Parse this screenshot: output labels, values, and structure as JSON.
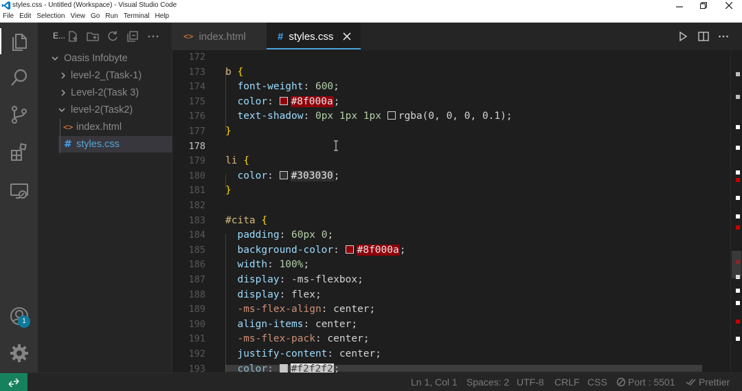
{
  "window": {
    "title": "styles.css - Untitled (Workspace) - Visual Studio Code",
    "menu": [
      "File",
      "Edit",
      "Selection",
      "View",
      "Go",
      "Run",
      "Terminal",
      "Help"
    ]
  },
  "activity_bar": {
    "icons": [
      "files-icon",
      "search-icon",
      "source-control-icon",
      "extensions-icon",
      "remote-explorer-icon",
      "accounts-icon",
      "settings-gear-icon"
    ],
    "accounts_badge": "1"
  },
  "sidebar": {
    "title": "E...",
    "tree": [
      {
        "label": "Oasis Infobyte",
        "kind": "folder",
        "expanded": true
      },
      {
        "label": "level-2_(Task-1)",
        "kind": "folder",
        "expanded": false
      },
      {
        "label": "Level-2(Task 3)",
        "kind": "folder",
        "expanded": false
      },
      {
        "label": "level-2(Task2)",
        "kind": "folder",
        "expanded": true
      },
      {
        "label": "index.html",
        "kind": "html",
        "icon": "<>"
      },
      {
        "label": "styles.css",
        "kind": "css",
        "icon": "#",
        "active": true
      }
    ]
  },
  "tabs": [
    {
      "label": "index.html",
      "icon": "<>",
      "active": false
    },
    {
      "label": "styles.css",
      "icon": "#",
      "active": true
    }
  ],
  "editor": {
    "lines": [
      {
        "n": "172",
        "tokens": []
      },
      {
        "n": "173",
        "tokens": [
          {
            "t": "b ",
            "c": "sel"
          },
          {
            "t": "{",
            "c": "brace"
          }
        ]
      },
      {
        "n": "174",
        "tokens": [
          {
            "t": "  font-weight",
            "c": "prop"
          },
          {
            "t": ": ",
            "c": "punc"
          },
          {
            "t": "600",
            "c": "num"
          },
          {
            "t": ";",
            "c": "punc"
          }
        ]
      },
      {
        "n": "175",
        "tokens": [
          {
            "t": "  color",
            "c": "prop"
          },
          {
            "t": ": ",
            "c": "punc"
          },
          {
            "t": "",
            "c": "swatch",
            "color": "#8f000a"
          },
          {
            "t": "#8f000a",
            "c": "hex",
            "hl": "#8f000a"
          },
          {
            "t": ";",
            "c": "punc"
          }
        ]
      },
      {
        "n": "176",
        "tokens": [
          {
            "t": "  text-shadow",
            "c": "prop"
          },
          {
            "t": ": ",
            "c": "punc"
          },
          {
            "t": "0px 1px 1px ",
            "c": "num"
          },
          {
            "t": "",
            "c": "swatch",
            "color": "#1e1e1e"
          },
          {
            "t": "rgba(0, 0, 0, 0.1)",
            "c": "plain"
          },
          {
            "t": ";",
            "c": "punc"
          }
        ]
      },
      {
        "n": "177",
        "tokens": [
          {
            "t": "}",
            "c": "brace"
          }
        ]
      },
      {
        "n": "178",
        "tokens": []
      },
      {
        "n": "179",
        "tokens": [
          {
            "t": "li ",
            "c": "sel"
          },
          {
            "t": "{",
            "c": "brace"
          }
        ]
      },
      {
        "n": "180",
        "tokens": [
          {
            "t": "  color",
            "c": "prop"
          },
          {
            "t": ": ",
            "c": "punc"
          },
          {
            "t": "",
            "c": "swatch",
            "color": "#303030"
          },
          {
            "t": "#303030",
            "c": "hex",
            "hl": "#303030"
          },
          {
            "t": ";",
            "c": "punc"
          }
        ]
      },
      {
        "n": "181",
        "tokens": [
          {
            "t": "}",
            "c": "brace"
          }
        ]
      },
      {
        "n": "182",
        "tokens": []
      },
      {
        "n": "183",
        "tokens": [
          {
            "t": "#cita ",
            "c": "sel"
          },
          {
            "t": "{",
            "c": "brace"
          }
        ]
      },
      {
        "n": "184",
        "tokens": [
          {
            "t": "  padding",
            "c": "prop"
          },
          {
            "t": ": ",
            "c": "punc"
          },
          {
            "t": "60px 0",
            "c": "num"
          },
          {
            "t": ";",
            "c": "punc"
          }
        ]
      },
      {
        "n": "185",
        "tokens": [
          {
            "t": "  background-color",
            "c": "prop"
          },
          {
            "t": ": ",
            "c": "punc"
          },
          {
            "t": "",
            "c": "swatch",
            "color": "#8f000a"
          },
          {
            "t": "#8f000a",
            "c": "hex",
            "hl": "#8f000a"
          },
          {
            "t": ";",
            "c": "punc"
          }
        ]
      },
      {
        "n": "186",
        "tokens": [
          {
            "t": "  width",
            "c": "prop"
          },
          {
            "t": ": ",
            "c": "punc"
          },
          {
            "t": "100%",
            "c": "num"
          },
          {
            "t": ";",
            "c": "punc"
          }
        ]
      },
      {
        "n": "187",
        "tokens": [
          {
            "t": "  display",
            "c": "prop"
          },
          {
            "t": ": ",
            "c": "punc"
          },
          {
            "t": "-ms-flexbox",
            "c": "plain"
          },
          {
            "t": ";",
            "c": "punc"
          }
        ]
      },
      {
        "n": "188",
        "tokens": [
          {
            "t": "  display",
            "c": "prop"
          },
          {
            "t": ": ",
            "c": "punc"
          },
          {
            "t": "flex",
            "c": "plain"
          },
          {
            "t": ";",
            "c": "punc"
          }
        ]
      },
      {
        "n": "189",
        "tokens": [
          {
            "t": "  -ms-flex-align",
            "c": "val"
          },
          {
            "t": ": ",
            "c": "punc"
          },
          {
            "t": "center",
            "c": "plain"
          },
          {
            "t": ";",
            "c": "punc"
          }
        ]
      },
      {
        "n": "190",
        "tokens": [
          {
            "t": "  align-items",
            "c": "prop"
          },
          {
            "t": ": ",
            "c": "punc"
          },
          {
            "t": "center",
            "c": "plain"
          },
          {
            "t": ";",
            "c": "punc"
          }
        ]
      },
      {
        "n": "191",
        "tokens": [
          {
            "t": "  -ms-flex-pack",
            "c": "val"
          },
          {
            "t": ": ",
            "c": "punc"
          },
          {
            "t": "center",
            "c": "plain"
          },
          {
            "t": ";",
            "c": "punc"
          }
        ]
      },
      {
        "n": "192",
        "tokens": [
          {
            "t": "  justify-content",
            "c": "prop"
          },
          {
            "t": ": ",
            "c": "punc"
          },
          {
            "t": "center",
            "c": "plain"
          },
          {
            "t": ";",
            "c": "punc"
          }
        ]
      },
      {
        "n": "193",
        "tokens": [
          {
            "t": "  color",
            "c": "prop"
          },
          {
            "t": ": ",
            "c": "punc"
          },
          {
            "t": "",
            "c": "swatch",
            "color": "#f2f2f2"
          },
          {
            "t": "#f2f2f2",
            "c": "hex",
            "hl": "#f2f2f2"
          },
          {
            "t": ";",
            "c": "punc"
          }
        ]
      }
    ],
    "current_line": "178"
  },
  "status_bar": {
    "position": "Ln 1, Col 1",
    "spaces": "Spaces: 2",
    "encoding": "UTF-8",
    "eol": "CRLF",
    "language": "CSS",
    "port": "Port : 5501",
    "formatter": "Prettier"
  },
  "colors": {
    "accent": "#4aa3d9",
    "remote": "#16825d",
    "badge": "#0e7a9c"
  }
}
